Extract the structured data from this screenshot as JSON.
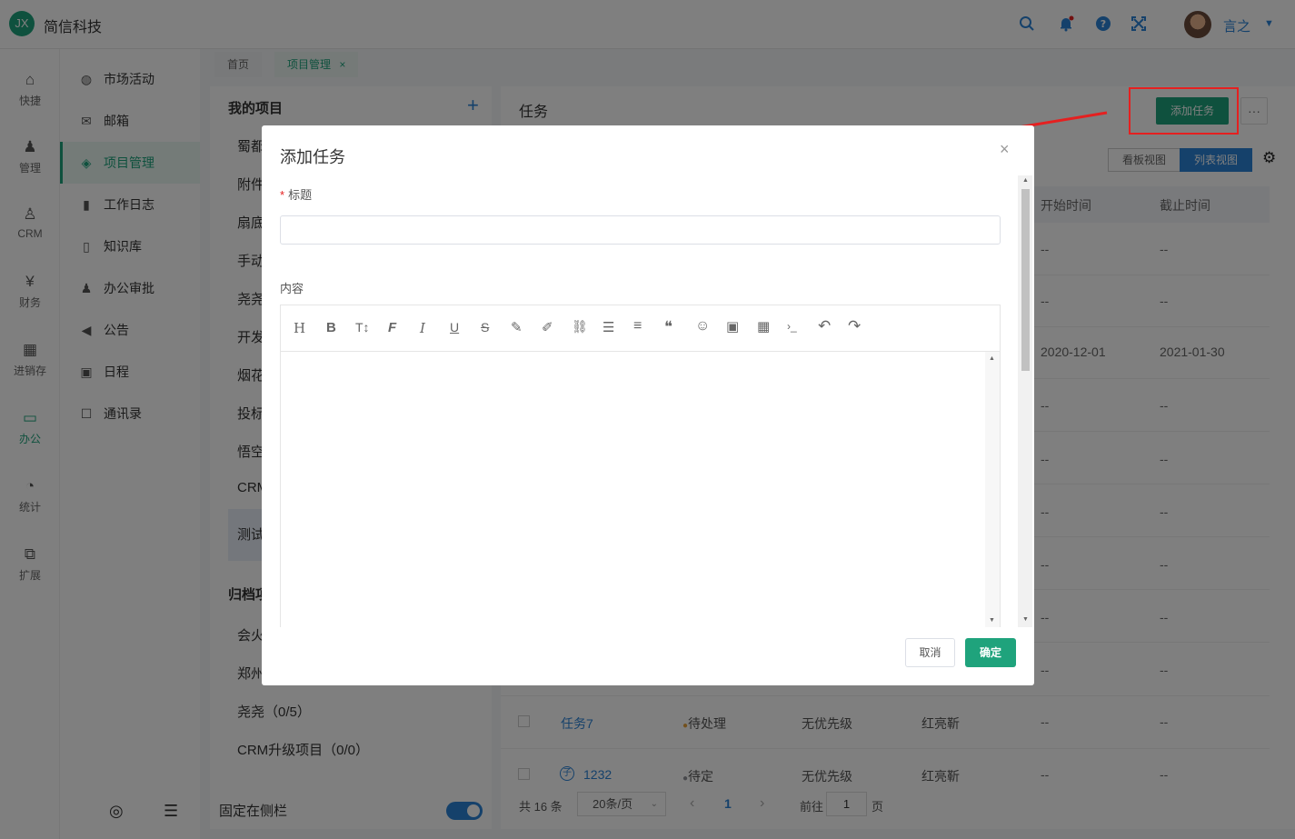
{
  "header": {
    "logo_text": "JX",
    "company": "简信科技",
    "user_name": "言之",
    "icons": [
      "search-icon",
      "bell-icon",
      "help-icon",
      "fullscreen-icon",
      "caret-down-icon"
    ],
    "accent": "#1fa37c",
    "link_color": "#2b83d6"
  },
  "left_nav": [
    {
      "label": "快捷",
      "icon": "home-icon"
    },
    {
      "label": "管理",
      "icon": "stamp-icon"
    },
    {
      "label": "CRM",
      "icon": "user-outline-icon"
    },
    {
      "label": "财务",
      "icon": "yen-icon"
    },
    {
      "label": "进销存",
      "icon": "warehouse-icon"
    },
    {
      "label": "办公",
      "icon": "monitor-icon"
    },
    {
      "label": "统计",
      "icon": "trend-icon"
    },
    {
      "label": "扩展",
      "icon": "extend-icon"
    }
  ],
  "sub_nav": [
    {
      "label": "市场活动",
      "icon": "globe-icon"
    },
    {
      "label": "邮箱",
      "icon": "mail-icon"
    },
    {
      "label": "项目管理",
      "icon": "layers-icon"
    },
    {
      "label": "工作日志",
      "icon": "book-icon"
    },
    {
      "label": "知识库",
      "icon": "notebook-icon"
    },
    {
      "label": "办公审批",
      "icon": "person-icon"
    },
    {
      "label": "公告",
      "icon": "megaphone-icon"
    },
    {
      "label": "日程",
      "icon": "calendar-icon"
    },
    {
      "label": "通讯录",
      "icon": "contacts-icon"
    }
  ],
  "tabs": [
    {
      "label": "首页"
    },
    {
      "label": "项目管理",
      "close": "×"
    }
  ],
  "projects": {
    "title": "我的项目",
    "add": "+",
    "items": [
      "蜀都",
      "附件",
      "扇底",
      "手动",
      "尧尧",
      "开发",
      "烟花",
      "投标",
      "悟空",
      "CRM",
      "测试"
    ],
    "archived_title": "归档项",
    "archived_items": [
      "会火",
      "郑州",
      "尧尧（0/5）",
      "CRM升级项目（0/0）"
    ],
    "pin_label": "固定在侧栏"
  },
  "tasks": {
    "title": "任务",
    "add_button": "添加任务",
    "more": "···",
    "view_board": "看板视图",
    "view_list": "列表视图",
    "columns": {
      "start": "开始时间",
      "due": "截止时间"
    },
    "rows": [
      {
        "start": "--",
        "due": "--"
      },
      {
        "start": "--",
        "due": "--"
      },
      {
        "start": "2020-12-01",
        "due": "2021-01-30"
      },
      {
        "start": "--",
        "due": "--"
      },
      {
        "start": "--",
        "due": "--"
      },
      {
        "start": "--",
        "due": "--"
      },
      {
        "start": "--",
        "due": "--"
      },
      {
        "start": "--",
        "due": "--"
      },
      {
        "start": "--",
        "due": "--"
      }
    ],
    "bottom_rows": [
      {
        "name": "任务7",
        "status": "待处理",
        "status_color": "#e6a23c",
        "priority": "无优先级",
        "owner": "红亮靳",
        "start": "--",
        "due": "--"
      },
      {
        "name": "1232",
        "status": "待定",
        "status_color": "#909399",
        "priority": "无优先级",
        "owner": "红亮靳",
        "start": "--",
        "due": "--"
      }
    ],
    "pagination": {
      "total": "共 16 条",
      "page_size": "20条/页",
      "prev": "‹",
      "current": "1",
      "next": "›",
      "goto": "前往",
      "goto_value": "1",
      "page_unit": "页"
    }
  },
  "dialog": {
    "title": "添加任务",
    "close": "×",
    "title_field": {
      "required": "*",
      "label": "标题",
      "value": "",
      "placeholder": ""
    },
    "content_field": {
      "label": "内容"
    },
    "toolbar": [
      "H",
      "B",
      "T↕",
      "F",
      "I",
      "U",
      "S",
      "✎",
      "✐",
      "⛓",
      "☰",
      "≡",
      "❝",
      "☺",
      "▣",
      "▦",
      "›_",
      "↶",
      "↷"
    ],
    "toolbar_names": [
      "heading-icon",
      "bold-icon",
      "font-size-icon",
      "font-family-icon",
      "italic-icon",
      "underline-icon",
      "strikethrough-icon",
      "highlight-icon",
      "brush-icon",
      "link-icon",
      "list-icon",
      "align-icon",
      "quote-icon",
      "emoji-icon",
      "image-icon",
      "table-icon",
      "code-icon",
      "undo-icon",
      "redo-icon"
    ],
    "cancel": "取消",
    "confirm": "确定"
  }
}
